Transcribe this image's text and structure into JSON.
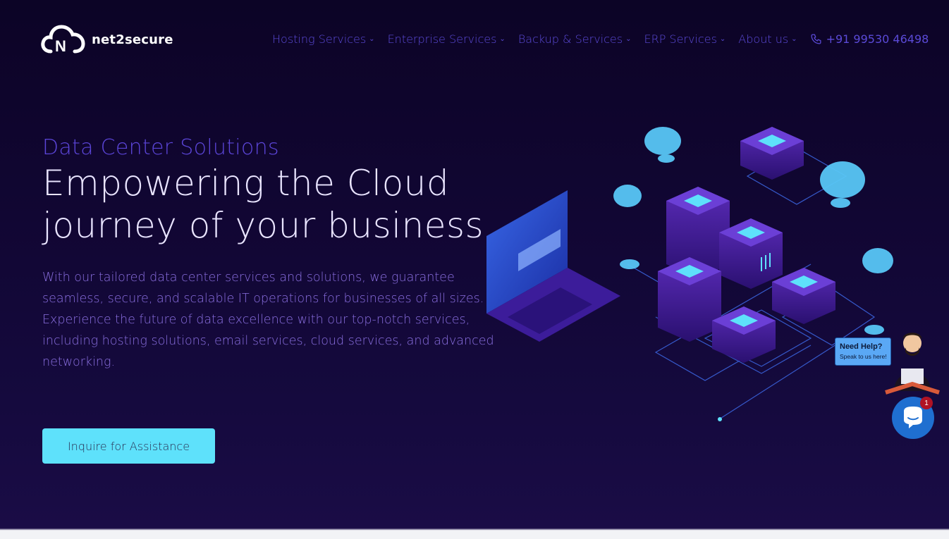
{
  "brand": {
    "name": "net2secure",
    "logo_icon": "cloud-n-logo"
  },
  "nav": {
    "items": [
      {
        "label": "Hosting Services"
      },
      {
        "label": "Enterprise Services"
      },
      {
        "label": "Backup & Services"
      },
      {
        "label": "ERP Services"
      },
      {
        "label": "About us"
      }
    ],
    "phone": "+91 99530 46498",
    "phone_icon": "phone-icon"
  },
  "hero": {
    "subtitle": "Data Center Solutions",
    "title": "Empowering the Cloud journey of your business",
    "description": "With our tailored data center services and solutions, we guarantee seamless, secure, and scalable IT operations for businesses of all sizes. Experience the future of data excellence with our top-notch services, including hosting solutions, email services, cloud services, and advanced networking.",
    "cta_label": "Inquire for Assistance"
  },
  "chat": {
    "help_title": "Need Help?",
    "help_subtitle": "Speak to us here!",
    "badge_count": "1"
  },
  "colors": {
    "background": "#110633",
    "accent": "#5ee1fb",
    "nav_text": "#5b4ad8",
    "title_text": "#e9e4ff"
  }
}
